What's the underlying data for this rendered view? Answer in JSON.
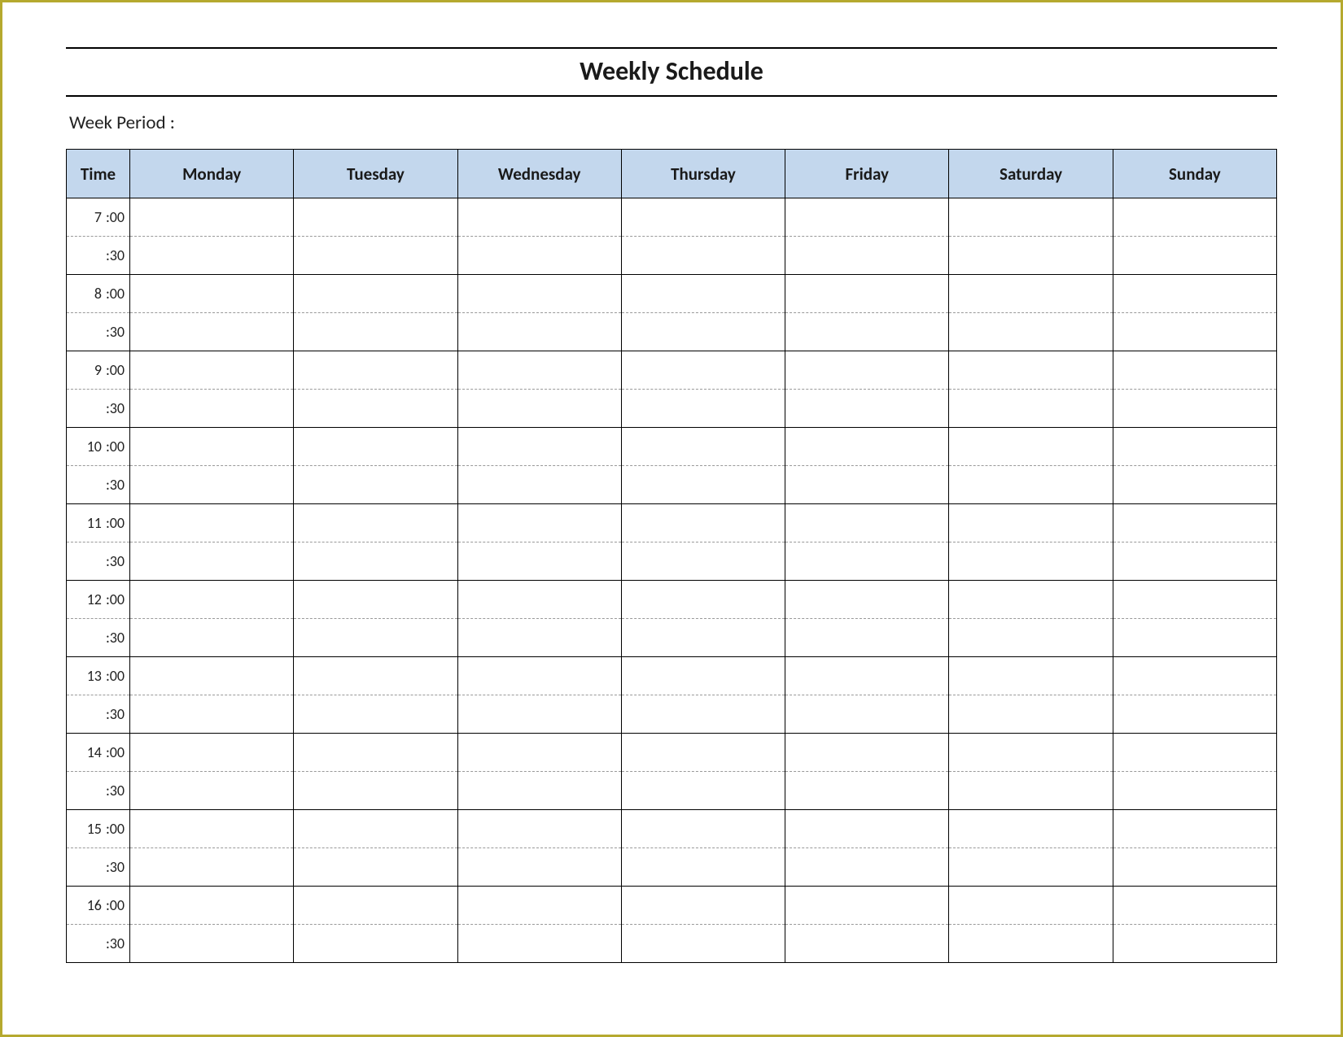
{
  "title": "Weekly Schedule",
  "week_period_label": "Week  Period :",
  "headers": [
    "Time",
    "Monday",
    "Tuesday",
    "Wednesday",
    "Thursday",
    "Friday",
    "Saturday",
    "Sunday"
  ],
  "time_rows": [
    {
      "hour": "7",
      "min": ":00"
    },
    {
      "hour": "",
      "min": ":30"
    },
    {
      "hour": "8",
      "min": ":00"
    },
    {
      "hour": "",
      "min": ":30"
    },
    {
      "hour": "9",
      "min": ":00"
    },
    {
      "hour": "",
      "min": ":30"
    },
    {
      "hour": "10",
      "min": ":00"
    },
    {
      "hour": "",
      "min": ":30"
    },
    {
      "hour": "11",
      "min": ":00"
    },
    {
      "hour": "",
      "min": ":30"
    },
    {
      "hour": "12",
      "min": ":00"
    },
    {
      "hour": "",
      "min": ":30"
    },
    {
      "hour": "13",
      "min": ":00"
    },
    {
      "hour": "",
      "min": ":30"
    },
    {
      "hour": "14",
      "min": ":00"
    },
    {
      "hour": "",
      "min": ":30"
    },
    {
      "hour": "15",
      "min": ":00"
    },
    {
      "hour": "",
      "min": ":30"
    },
    {
      "hour": "16",
      "min": ":00"
    },
    {
      "hour": "",
      "min": ":30"
    }
  ],
  "colors": {
    "frame_border": "#b5a92e",
    "header_bg": "#c3d7ed"
  }
}
